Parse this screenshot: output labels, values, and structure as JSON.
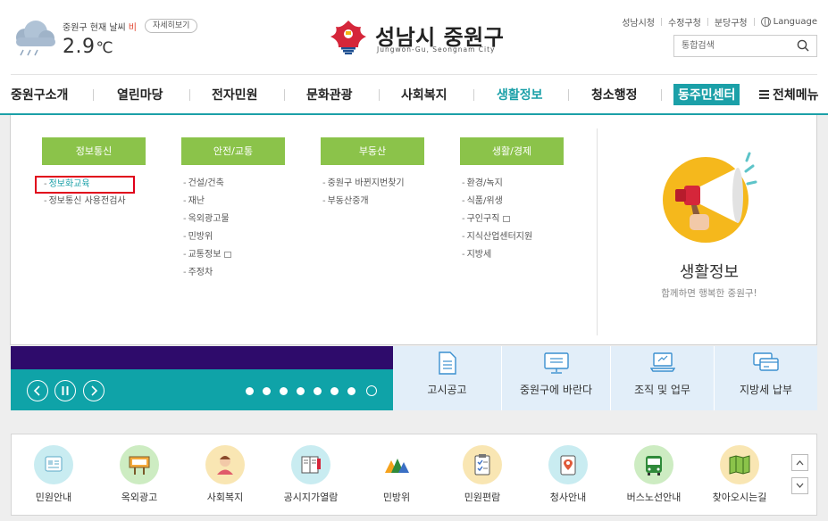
{
  "weather": {
    "label": "중원구 현재 날씨",
    "condition": "비",
    "detail_button": "자세히보기",
    "temperature": "2.9",
    "unit": "℃"
  },
  "logo": {
    "name": "성남시 중원구",
    "english": "Jungwon-Gu, Seongnam City"
  },
  "util_links": [
    "성남시청",
    "수정구청",
    "분당구청",
    "Language"
  ],
  "search": {
    "placeholder": "통합검색"
  },
  "gnb": {
    "items": [
      "중원구소개",
      "열린마당",
      "전자민원",
      "문화관광",
      "사회복지",
      "생활정보",
      "청소행정",
      "동주민센터"
    ],
    "active": "생활정보",
    "all_menu": "전체메뉴"
  },
  "dropdown": {
    "columns": [
      {
        "title": "정보통신",
        "items": [
          "정보화교육",
          "정보통신 사용전검사"
        ]
      },
      {
        "title": "안전/교통",
        "items": [
          "건설/건축",
          "재난",
          "옥외광고물",
          "민방위",
          "교통정보",
          "주정차"
        ]
      },
      {
        "title": "부동산",
        "items": [
          "중원구 바뀐지번찾기",
          "부동산중개"
        ]
      },
      {
        "title": "생활/경제",
        "items": [
          "환경/녹지",
          "식품/위생",
          "구인구직",
          "지식산업센터지원",
          "지방세"
        ]
      }
    ],
    "highlighted_item": "정보화교육",
    "promo_title": "생활정보",
    "promo_subtitle": "함께하면 행복한 중원구!"
  },
  "slider": {
    "dot_count": 8,
    "current_dot": 8
  },
  "quick_links": [
    "고시공고",
    "중원구에 바란다",
    "조직 및 업무",
    "지방세 납부"
  ],
  "bottom_links": [
    "민원안내",
    "옥외광고",
    "사회복지",
    "공시지가열람",
    "민방위",
    "민원편람",
    "청사안내",
    "버스노선안내",
    "찾아오시는길"
  ],
  "colors": {
    "accent_teal": "#1ba0a8",
    "menu_green": "#8bc34a",
    "highlight_red": "#e0001b",
    "banner_purple": "#2e0b6b",
    "quick_bg": "#e2eef9"
  }
}
